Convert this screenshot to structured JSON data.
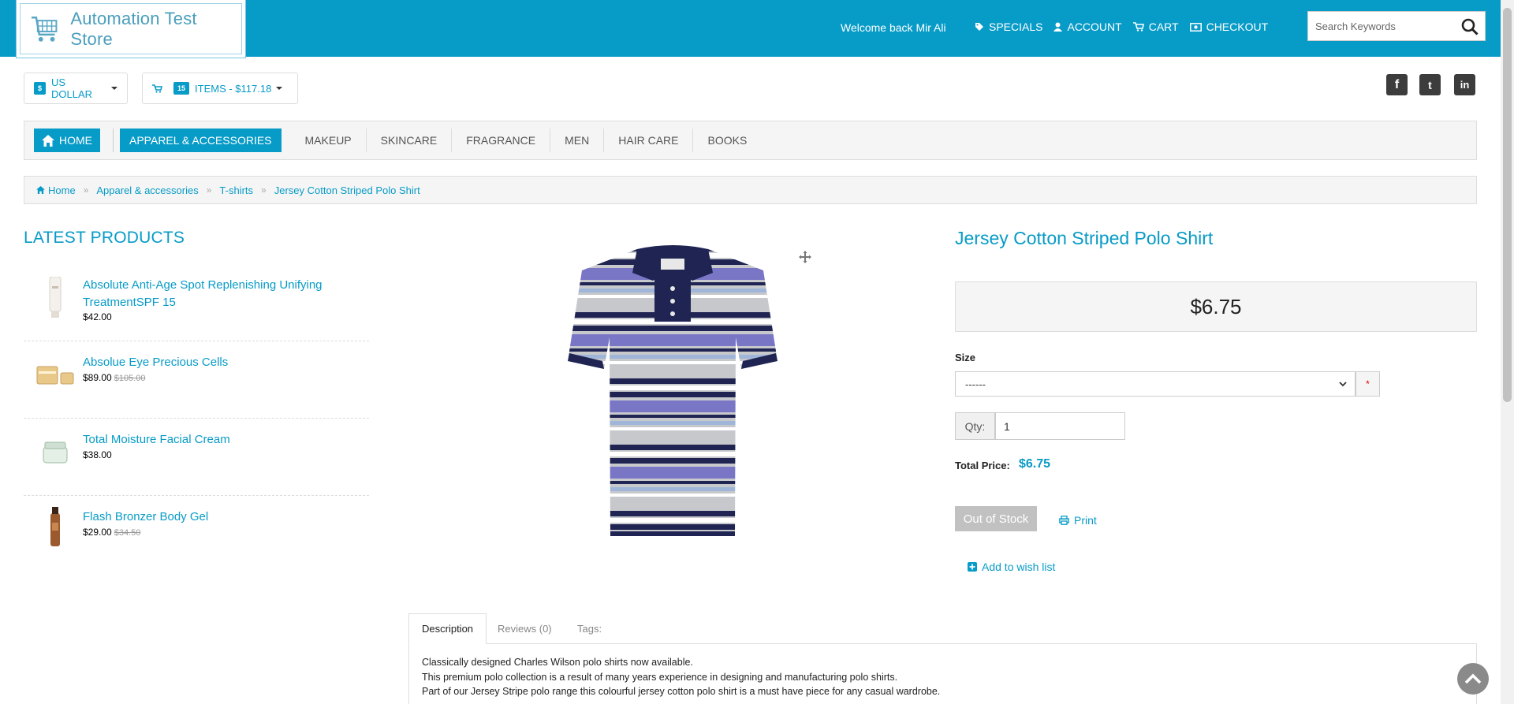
{
  "header": {
    "store_name": "Automation Test Store",
    "welcome": "Welcome back Mir Ali",
    "links": [
      {
        "label": "SPECIALS",
        "icon": "tag-icon"
      },
      {
        "label": "ACCOUNT",
        "icon": "user-icon"
      },
      {
        "label": "CART",
        "icon": "cart-icon"
      },
      {
        "label": "CHECKOUT",
        "icon": "money-icon"
      }
    ],
    "search_placeholder": "Search Keywords"
  },
  "currency": {
    "symbol": "$",
    "label": "US DOLLAR"
  },
  "cart_summary": {
    "count": "15",
    "label": "ITEMS - $117.18"
  },
  "social": [
    "f",
    "t",
    "in"
  ],
  "nav": {
    "home": "HOME",
    "items": [
      "APPAREL & ACCESSORIES",
      "MAKEUP",
      "SKINCARE",
      "FRAGRANCE",
      "MEN",
      "HAIR CARE",
      "BOOKS"
    ]
  },
  "breadcrumb": [
    "Home",
    "Apparel & accessories",
    "T-shirts",
    "Jersey Cotton Striped Polo Shirt"
  ],
  "sidebar": {
    "title": "LATEST PRODUCTS",
    "items": [
      {
        "name": "Absolute Anti-Age Spot Replenishing Unifying TreatmentSPF 15",
        "price": "$42.00",
        "old_price": ""
      },
      {
        "name": "Absolue Eye Precious Cells",
        "price": "$89.00",
        "old_price": "$105.00"
      },
      {
        "name": "Total Moisture Facial Cream",
        "price": "$38.00",
        "old_price": ""
      },
      {
        "name": "Flash Bronzer Body Gel",
        "price": "$29.00",
        "old_price": "$34.50"
      }
    ]
  },
  "product": {
    "title": "Jersey Cotton Striped Polo Shirt",
    "price": "$6.75",
    "size_label": "Size",
    "size_value": "------",
    "required_mark": "*",
    "qty_label": "Qty:",
    "qty_value": "1",
    "total_label": "Total Price:",
    "total_value": "$6.75",
    "stock_button": "Out of Stock",
    "print_label": "Print",
    "wishlist_label": "Add to wish list"
  },
  "tabs": {
    "items": [
      "Description",
      "Reviews (0)",
      "Tags:"
    ],
    "description": [
      "Classically designed Charles Wilson polo shirts now available.",
      "This premium polo collection is a result of many years experience in designing and manufacturing polo shirts.",
      "Part of our Jersey Stripe polo range this colourful jersey cotton polo shirt is a must have piece for any casual wardrobe."
    ]
  },
  "colors": {
    "accent": "#079bc7",
    "disabled_button": "#c1c1c1"
  }
}
